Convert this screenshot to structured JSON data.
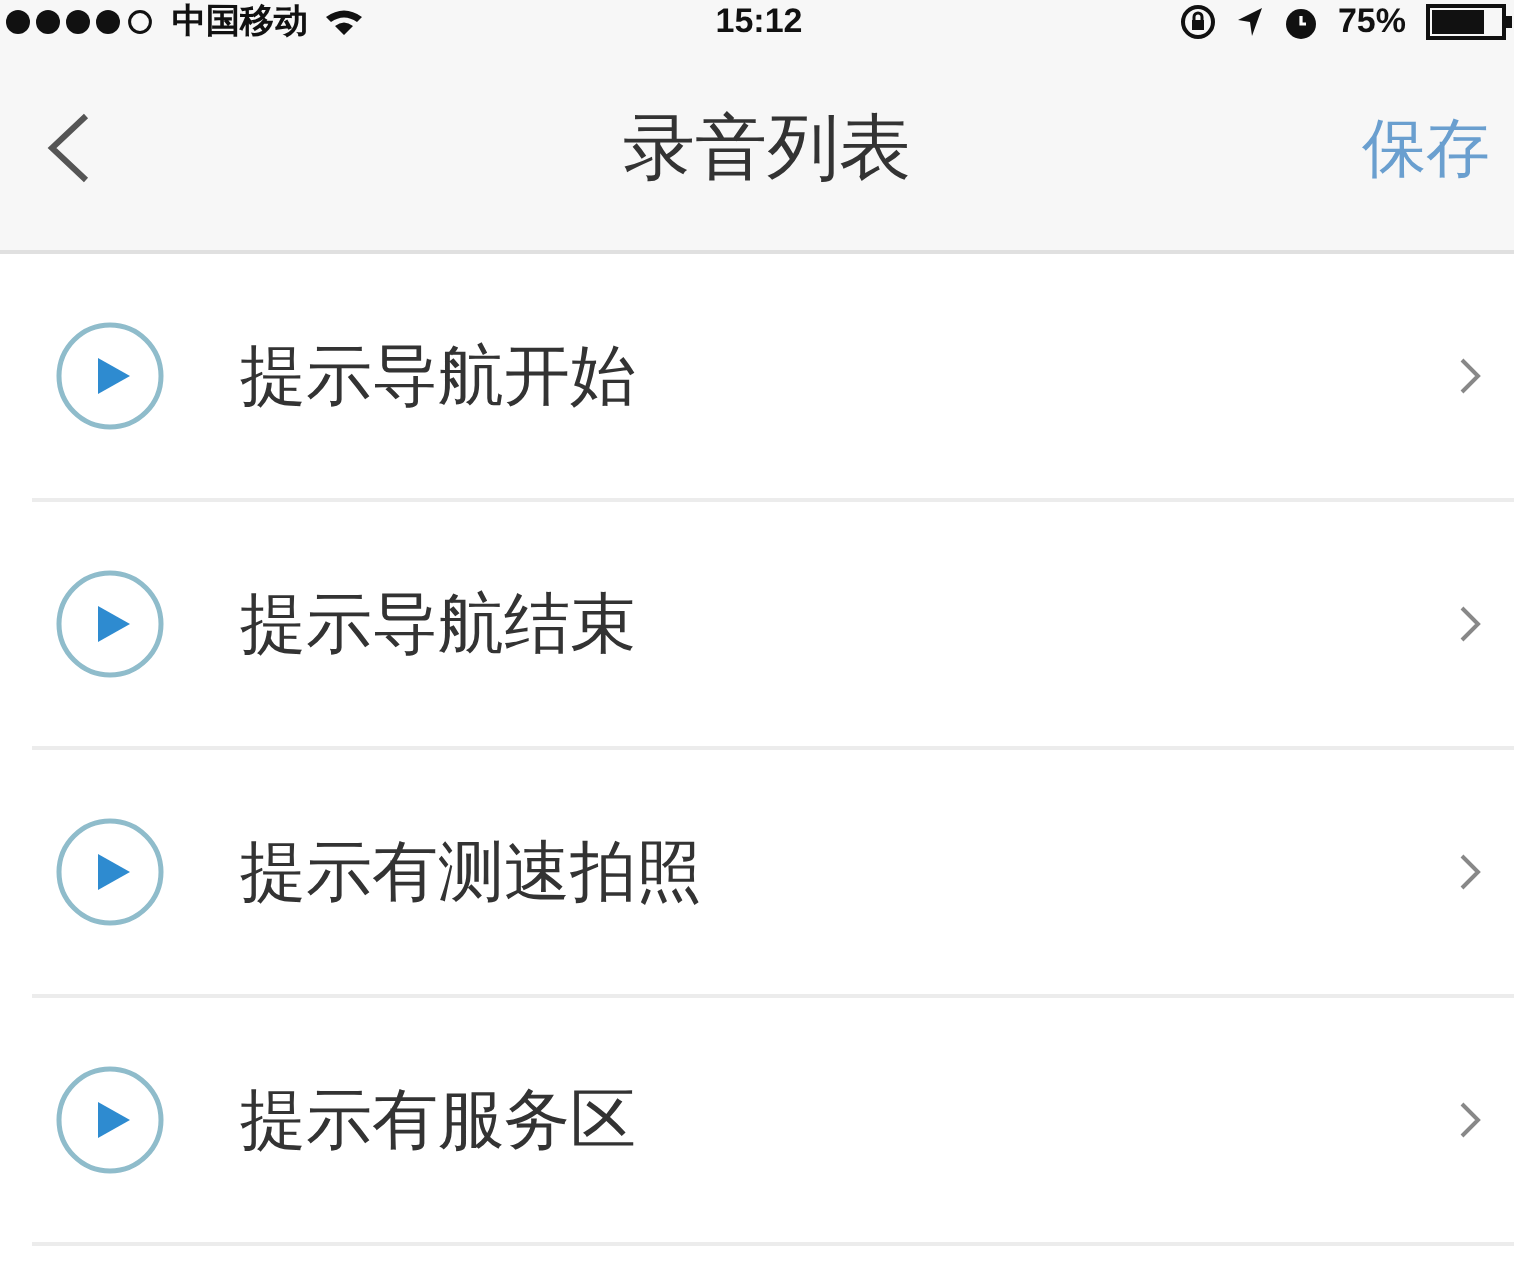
{
  "status_bar": {
    "carrier": "中国移动",
    "time": "15:12",
    "battery": "75%"
  },
  "nav_bar": {
    "title": "录音列表",
    "action": "保存"
  },
  "recordings": [
    {
      "label": "提示导航开始"
    },
    {
      "label": "提示导航结束"
    },
    {
      "label": "提示有测速拍照"
    },
    {
      "label": "提示有服务区"
    }
  ]
}
